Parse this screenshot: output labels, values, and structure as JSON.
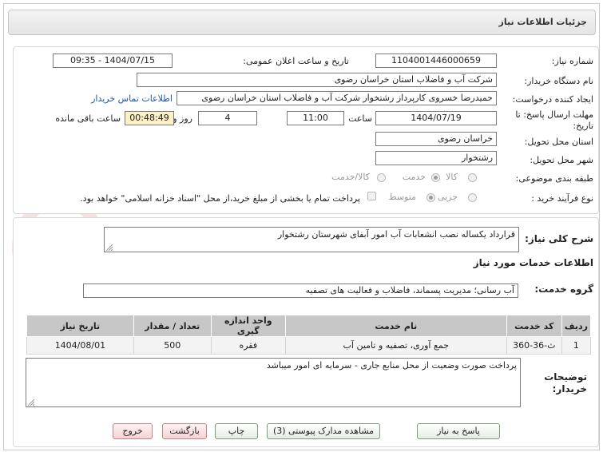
{
  "header": {
    "title": "جزئیات اطلاعات نیاز"
  },
  "form": {
    "need_number_label": "شماره نیاز:",
    "need_number": "1104001446000659",
    "announce_label": "تاریخ و ساعت اعلان عمومی:",
    "announce_value": "1404/07/15 - 09:35",
    "buyer_org_label": "نام دستگاه خریدار:",
    "buyer_org": "شرکت آب و فاضلاب استان خراسان رضوی",
    "creator_label": "ایجاد کننده درخواست:",
    "creator": "حمیدرضا خسروی کارپرداز  رشتخوار  شرکت آب و فاضلاب استان خراسان رضوی",
    "contact_link": "اطلاعات تماس خریدار",
    "deadline_label_1": "مهلت ارسال پاسخ: تا",
    "deadline_label_2": "تاریخ:",
    "deadline_date": "1404/07/19",
    "time_label": "ساعت",
    "deadline_time": "11:00",
    "days_value": "4",
    "days_label": "روز و",
    "remaining_time": "00:48:49",
    "remaining_label": "ساعت باقی مانده",
    "province_label": "استان محل تحویل:",
    "province": "خراسان رضوی",
    "city_label": "شهر محل تحویل:",
    "city": "رشتخوار",
    "category_label": "طبقه بندی موضوعی:",
    "category_options": [
      "کالا",
      "خدمت",
      "کالا/خدمت"
    ],
    "category_selected": "خدمت",
    "process_label": "نوع فرآیند خرید :",
    "process_options": [
      "جزیی",
      "متوسط"
    ],
    "process_selected": "متوسط",
    "payment_note": "پرداخت تمام یا بخشی از مبلغ خرید،از محل \"اسناد خزانه اسلامی\" خواهد بود."
  },
  "summary": {
    "label": "شرح کلی نیاز:",
    "text": "قرارداد یکساله نصب انشعابات آب امور آبفای شهرستان رشتخوار"
  },
  "services": {
    "section_title": "اطلاعات خدمات مورد نیاز",
    "group_label": "گروه خدمت:",
    "group_value": "آب رسانی؛ مدیریت پسماند، فاضلاب و فعالیت های تصفیه",
    "columns": [
      "ردیف",
      "کد خدمت",
      "نام خدمت",
      "واحد اندازه گیری",
      "تعداد / مقدار",
      "تاریخ نیاز"
    ],
    "rows": [
      [
        "1",
        "ث-36-360",
        "جمع آوری، تصفیه و تامین آب",
        "فقره",
        "500",
        "1404/08/01"
      ]
    ]
  },
  "notes": {
    "label_1": "توضیحات",
    "label_2": "خریدار:",
    "text": "پرداخت صورت وضعیت از محل منابع جاری - سرمایه ای امور میباشد"
  },
  "buttons": {
    "reply": "پاسخ به نیاز",
    "view_docs": "مشاهده مدارک پیوستی (3)",
    "print": "چاپ",
    "back": "بازگشت",
    "exit": "خروج"
  },
  "watermark": {
    "text": "AriaTender.net"
  },
  "colors": {
    "accent_link": "#1a55b0",
    "remaining_bg": "#fbf1c4",
    "watermark": "#f1d6d6"
  }
}
